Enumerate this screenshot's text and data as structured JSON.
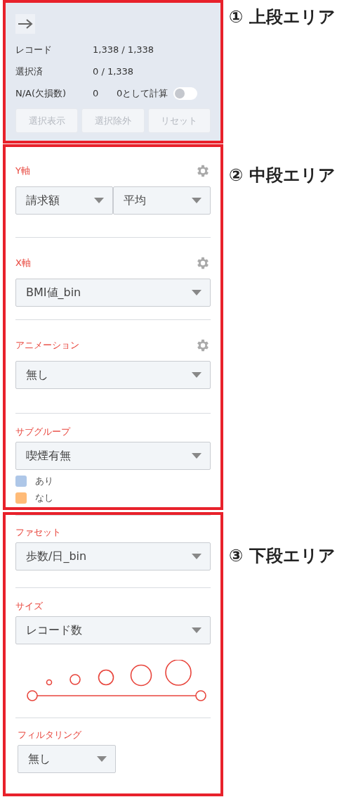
{
  "areas": [
    {
      "callout": "① 上段エリア",
      "kind": "summary",
      "stats": [
        {
          "label": "レコード",
          "value": "1,338 / 1,338"
        },
        {
          "label": "選択済",
          "value": "0 / 1,338"
        }
      ],
      "na": {
        "label": "N/A(欠損数)",
        "value": "0",
        "toggle_label": "0として計算",
        "on": false
      },
      "buttons": [
        {
          "label": "選択表示",
          "disabled": true
        },
        {
          "label": "選択除外",
          "disabled": true
        },
        {
          "label": "リセット",
          "disabled": true
        }
      ]
    },
    {
      "callout": "② 中段エリア",
      "kind": "settings",
      "sections": [
        {
          "kind": "select",
          "title": "Y軸",
          "gear": true,
          "selects": [
            "請求額",
            "平均"
          ]
        },
        {
          "kind": "select",
          "title": "X軸",
          "gear": true,
          "selects": [
            "BMI値_bin"
          ]
        },
        {
          "kind": "select",
          "title": "アニメーション",
          "gear": true,
          "selects": [
            "無し"
          ]
        },
        {
          "kind": "select",
          "title": "サブグループ",
          "gear": false,
          "selects": [
            "喫煙有無"
          ],
          "legend": [
            {
              "label": "あり",
              "color": "#aec7e8"
            },
            {
              "label": "なし",
              "color": "#ffbb78"
            }
          ]
        }
      ]
    },
    {
      "callout": "③ 下段エリア",
      "kind": "settings",
      "sections": [
        {
          "kind": "select",
          "title": "ファセット",
          "gear": false,
          "selects": [
            "歩数/日_bin"
          ]
        },
        {
          "kind": "size",
          "title": "サイズ",
          "gear": false,
          "selects": [
            "レコード数"
          ]
        },
        {
          "kind": "narrow",
          "title": "フィルタリング",
          "gear": false,
          "selects": [
            "無し"
          ]
        }
      ]
    }
  ]
}
